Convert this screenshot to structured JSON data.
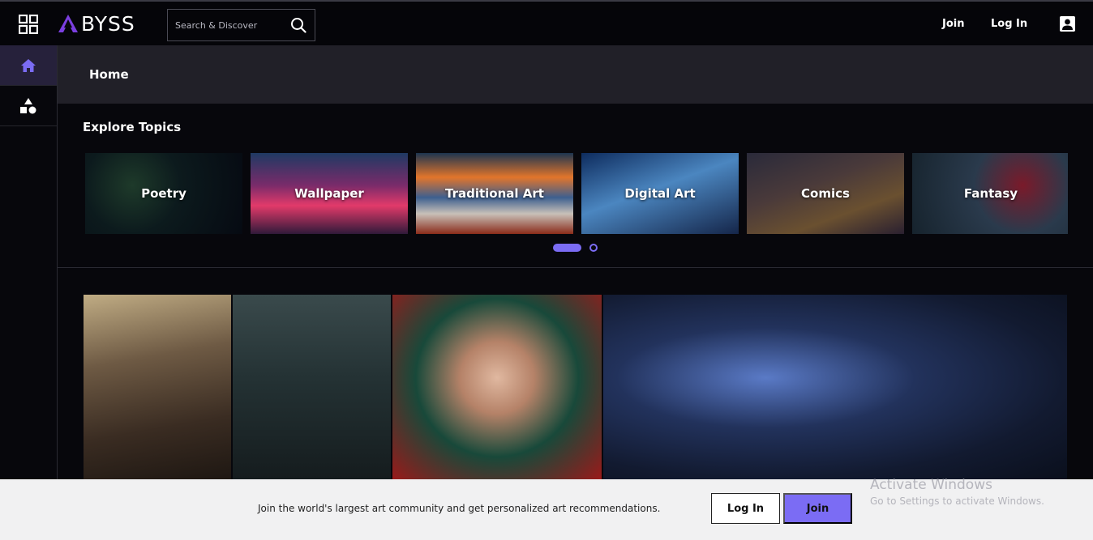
{
  "header": {
    "logo_text": "BYSS",
    "search_placeholder": "Search & Discover",
    "join_label": "Join",
    "login_label": "Log In"
  },
  "home": {
    "title": "Home"
  },
  "topics": {
    "title": "Explore Topics",
    "items": [
      {
        "label": "Poetry"
      },
      {
        "label": "Wallpaper"
      },
      {
        "label": "Traditional Art"
      },
      {
        "label": "Digital Art"
      },
      {
        "label": "Comics"
      },
      {
        "label": "Fantasy"
      }
    ],
    "carousel_pages": 2,
    "carousel_active": 1
  },
  "cta": {
    "message": "Join the world's largest art community and get personalized art recommendations.",
    "login_label": "Log In",
    "join_label": "Join"
  },
  "watermark": {
    "title": "Activate Windows",
    "subtitle": "Go to Settings to activate Windows."
  },
  "colors": {
    "accent": "#7b6cf4",
    "page_bg": "#07070c",
    "banner_bg": "#212028",
    "cta_bg": "#f1f1f2"
  },
  "icons": [
    "apps-grid-icon",
    "abyss-logo-icon",
    "search-icon",
    "user-icon",
    "home-icon",
    "shapes-icon"
  ]
}
